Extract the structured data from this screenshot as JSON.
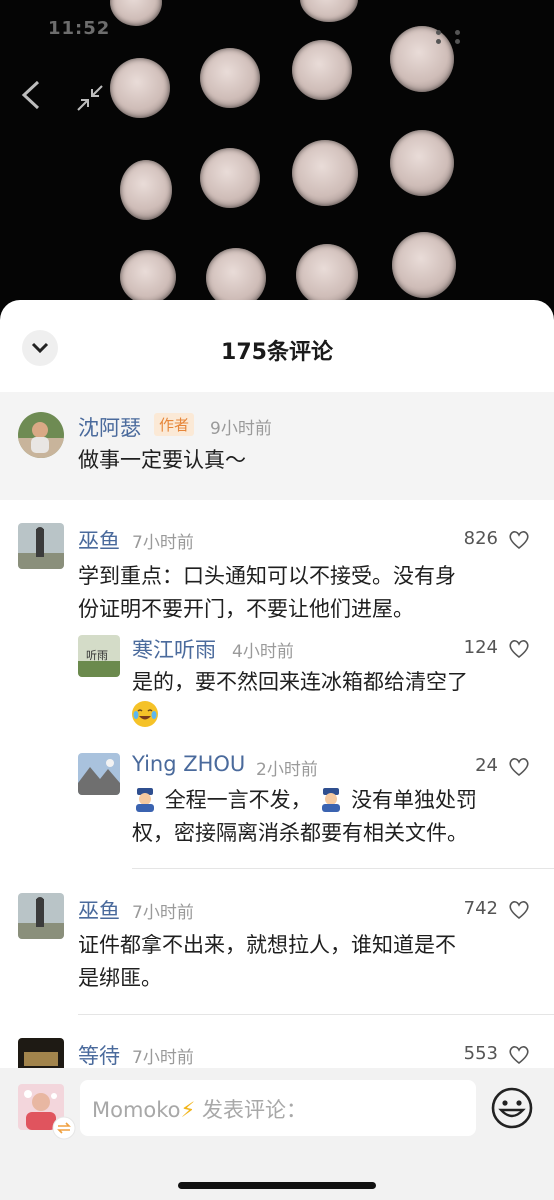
{
  "status_bar": {
    "time": "11:52"
  },
  "video": {
    "back_icon": "chevron-left-icon",
    "shrink_icon": "shrink-arrows-icon"
  },
  "panel": {
    "title": "175条评论",
    "collapse_icon": "chevron-down-icon"
  },
  "author_post": {
    "username": "沈阿瑟",
    "tag": "作者",
    "time": "9小时前",
    "text": "做事一定要认真～"
  },
  "comments": [
    {
      "username": "巫鱼",
      "time": "7小时前",
      "likes": "826",
      "lines": [
        "学到重点：口头通知可以不接受。没有身",
        "份证明不要开门，不要让他们进屋。"
      ]
    },
    {
      "username": "巫鱼",
      "time": "7小时前",
      "likes": "742",
      "lines": [
        "证件都拿不出来，就想拉人，谁知道是不",
        "是绑匪。"
      ]
    },
    {
      "username": "等待",
      "time": "7小时前",
      "likes": "553"
    }
  ],
  "replies": [
    {
      "username": "寒江听雨",
      "time": "4小时前",
      "likes": "124",
      "avatar_text": "听雨",
      "lines": [
        "是的，要不然回来连冰箱都给清空了"
      ]
    },
    {
      "username": "Ying ZHOU",
      "time": "2小时前",
      "likes": "24",
      "line1": "全程一言不发，",
      "line1b": "没有单独处罚",
      "line2": "权，密接隔离消杀都要有相关文件。"
    }
  ],
  "input_bar": {
    "nickname": "Momoko",
    "placeholder": "发表评论：",
    "emoji_icon": "smiley-face-icon"
  },
  "colors": {
    "username": "#4a6a9c",
    "author_tag": "#e6863a",
    "panel_bg": "#ffffff"
  }
}
